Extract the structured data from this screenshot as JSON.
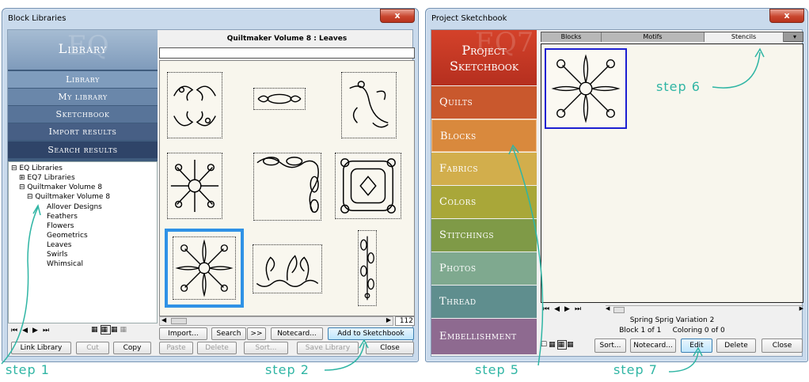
{
  "left_window": {
    "title": "Block Libraries",
    "close_label": "x",
    "library_header": "Library",
    "library_header_watermark": "EQ",
    "nav": [
      "Library",
      "My library",
      "Sketchbook",
      "Import results",
      "Search results"
    ],
    "tree": {
      "root": "EQ Libraries",
      "items": [
        "EQ7 Libraries",
        "Quiltmaker Volume 8",
        "Quiltmaker Volume 8"
      ],
      "leaves": [
        "Allover Designs",
        "Feathers",
        "Flowers",
        "Geometrics",
        "Leaves",
        "Swirls",
        "Whimsical"
      ]
    },
    "panel_title": "Quiltmaker Volume 8  :  Leaves",
    "count": "112",
    "buttons": {
      "import": "Import...",
      "search": "Search",
      "search_more": ">>",
      "notecard": "Notecard...",
      "add_to_sketchbook": "Add to Sketchbook",
      "link_library": "Link Library",
      "cut": "Cut",
      "copy": "Copy",
      "paste": "Paste",
      "delete": "Delete",
      "sort": "Sort...",
      "save_library": "Save Library",
      "close": "Close"
    }
  },
  "right_window": {
    "title": "Project Sketchbook",
    "close_label": "x",
    "header_line1": "Project",
    "header_line2": "Sketchbook",
    "header_watermark": "EQ7",
    "sections": [
      {
        "label": "Quilts",
        "color": "#c9582d"
      },
      {
        "label": "Blocks",
        "color": "#d9893d"
      },
      {
        "label": "Fabrics",
        "color": "#d2ae4c"
      },
      {
        "label": "Colors",
        "color": "#a9a739"
      },
      {
        "label": "Stitchings",
        "color": "#7f9a47"
      },
      {
        "label": "Photos",
        "color": "#7fa98f"
      },
      {
        "label": "Thread",
        "color": "#5f8e8e"
      },
      {
        "label": "Embellishment",
        "color": "#8e6a90"
      }
    ],
    "tabs": [
      "Blocks",
      "Motifs",
      "Stencils"
    ],
    "tab_menu": "▾",
    "status_name": "Spring Sprig Variation 2",
    "status_block": "Block 1 of 1",
    "status_coloring": "Coloring 0 of 0",
    "buttons": {
      "sort": "Sort...",
      "notecard": "Notecard...",
      "edit": "Edit",
      "delete": "Delete",
      "close": "Close"
    }
  },
  "annotations": {
    "step1": "step 1",
    "step2": "step 2",
    "step5": "step 5",
    "step6": "step 6",
    "step7": "step 7"
  },
  "colors": {
    "accent_step": "#2fb5a4",
    "selection_blue": "#1e73e0"
  }
}
